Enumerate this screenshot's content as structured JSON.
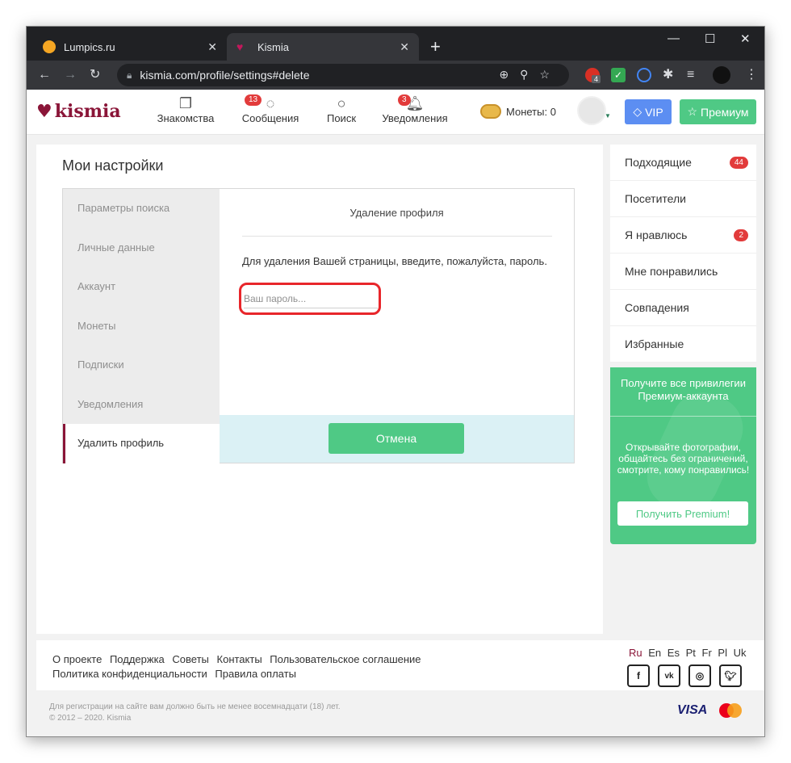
{
  "browser": {
    "tabs": [
      {
        "title": "Lumpics.ru",
        "favicon_color": "#f5a623"
      },
      {
        "title": "Kismia",
        "favicon_color": "#8a1538"
      }
    ],
    "url": "kismia.com/profile/settings#delete",
    "ext_badge": "4"
  },
  "site": {
    "logo": "kismia",
    "nav": [
      {
        "label": "Знакомства",
        "icon": "cards-icon"
      },
      {
        "label": "Сообщения",
        "icon": "chat-icon",
        "badge": "13"
      },
      {
        "label": "Поиск",
        "icon": "search-icon"
      },
      {
        "label": "Уведомления",
        "icon": "bell-icon",
        "badge": "3"
      }
    ],
    "coins_label": "Монеты: 0",
    "vip_label": "VIP",
    "premium_label": "Премиум"
  },
  "settings": {
    "page_title": "Мои настройки",
    "menu": [
      "Параметры поиска",
      "Личные данные",
      "Аккаунт",
      "Монеты",
      "Подписки",
      "Уведомления",
      "Удалить профиль"
    ],
    "content_title": "Удаление профиля",
    "description": "Для удаления Вашей страницы, введите, пожалуйста, пароль.",
    "password_placeholder": "Ваш пароль...",
    "cancel_label": "Отмена"
  },
  "sidebar": {
    "items": [
      {
        "label": "Подходящие",
        "badge": "44"
      },
      {
        "label": "Посетители"
      },
      {
        "label": "Я нравлюсь",
        "badge": "2"
      },
      {
        "label": "Мне понравились"
      },
      {
        "label": "Совпадения"
      },
      {
        "label": "Избранные"
      }
    ],
    "promo_head": "Получите все привилегии Премиум-аккаунта",
    "promo_text": "Открывайте фотографии, общайтесь без ограничений, смотрите, кому понравились!",
    "promo_button": "Получить Premium!"
  },
  "footer": {
    "links_row1": [
      "О проекте",
      "Поддержка",
      "Советы",
      "Контакты",
      "Пользовательское соглашение"
    ],
    "links_row2": [
      "Политика конфиденциальности",
      "Правила оплаты"
    ],
    "langs": [
      "Ru",
      "En",
      "Es",
      "Pt",
      "Fr",
      "Pl",
      "Uk"
    ],
    "legal_line1": "Для регистрации на сайте вам должно быть не менее восемнадцати (18) лет.",
    "legal_line2": "© 2012 – 2020. Kismia",
    "visa": "VISA"
  },
  "colors": {
    "brand": "#8a1538",
    "green": "#4fc985",
    "vip_blue": "#5c8ef2",
    "highlight_red": "#e8262b"
  }
}
